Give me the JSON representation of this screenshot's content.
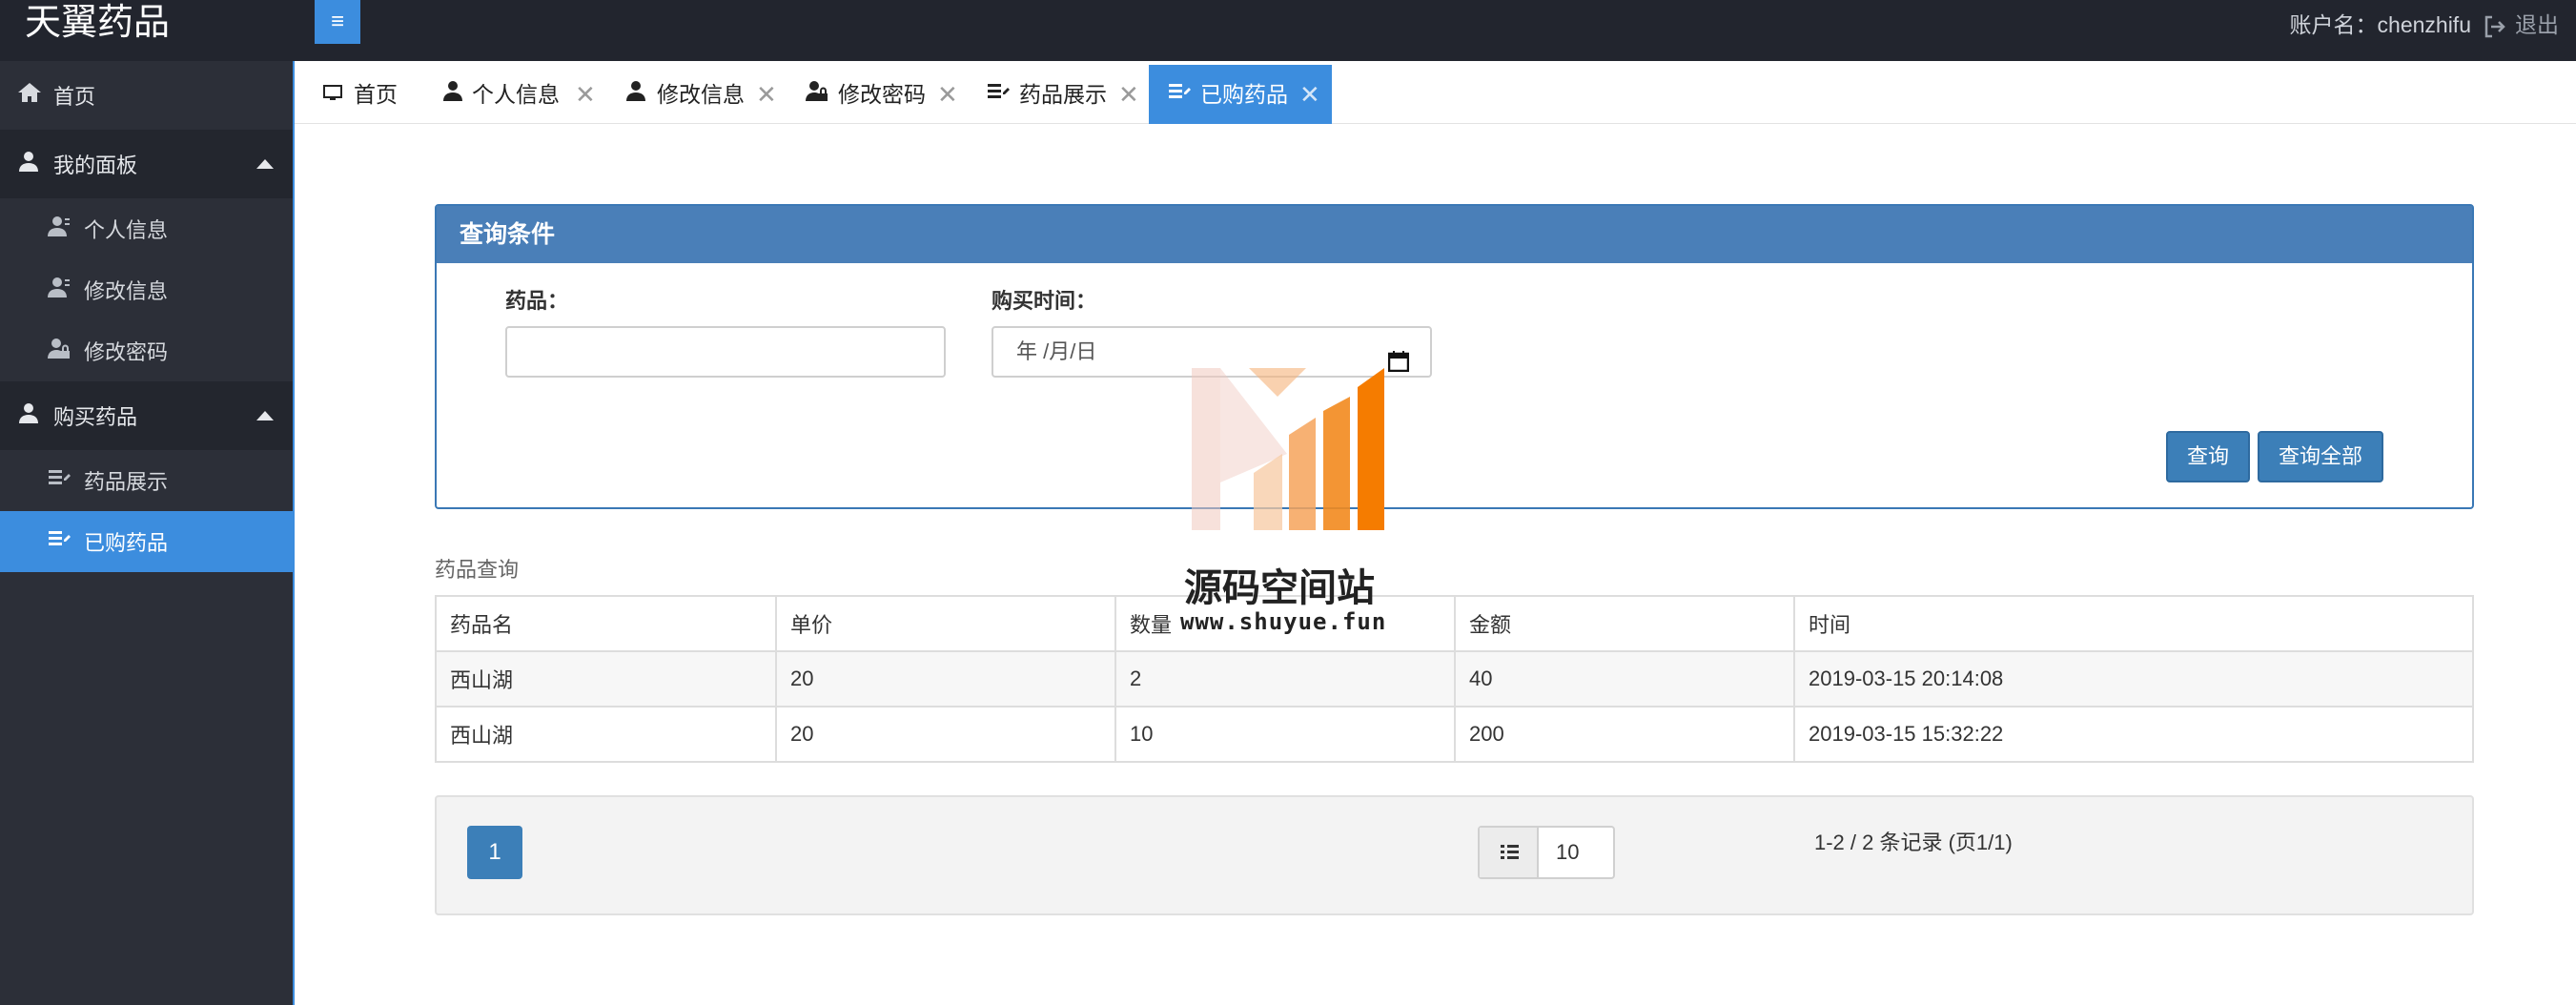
{
  "app": {
    "title": "天翼药品",
    "menu_toggle": "≡"
  },
  "header": {
    "account_label": "账户名：chenzhifu",
    "logout_label": "退出"
  },
  "sidebar": {
    "home": "首页",
    "groups": [
      {
        "label": "我的面板",
        "items": [
          "个人信息",
          "修改信息",
          "修改密码"
        ]
      },
      {
        "label": "购买药品",
        "items": [
          "药品展示",
          "已购药品"
        ]
      }
    ],
    "active_item": "已购药品"
  },
  "tabs": [
    {
      "label": "首页",
      "closable": false
    },
    {
      "label": "个人信息",
      "closable": true
    },
    {
      "label": "修改信息",
      "closable": true
    },
    {
      "label": "修改密码",
      "closable": true
    },
    {
      "label": "药品展示",
      "closable": true
    },
    {
      "label": "已购药品",
      "closable": true,
      "active": true
    }
  ],
  "tab_close_glyph": "✕",
  "query": {
    "title": "查询条件",
    "drug_label": "药品：",
    "drug_value": "",
    "time_label": "购买时间：",
    "time_placeholder": "年 /月/日",
    "search_button": "查询",
    "search_all_button": "查询全部"
  },
  "table": {
    "caption": "药品查询",
    "columns": [
      "药品名",
      "单价",
      "数量",
      "金额",
      "时间"
    ],
    "rows": [
      [
        "西山湖",
        "20",
        "2",
        "40",
        "2019-03-15 20:14:08"
      ],
      [
        "西山湖",
        "20",
        "10",
        "200",
        "2019-03-15 15:32:22"
      ]
    ]
  },
  "pagination": {
    "current_page": "1",
    "page_size": "10",
    "record_info": "1-2 / 2 条记录 (页1/1)"
  },
  "watermark": {
    "name": "源码空间站",
    "url": "www.shuyue.fun"
  },
  "colors": {
    "accent": "#3c8dde",
    "sidebar_bg": "#2c2f38",
    "topbar_bg": "#22252e",
    "panel_head": "#4a7fb8"
  }
}
